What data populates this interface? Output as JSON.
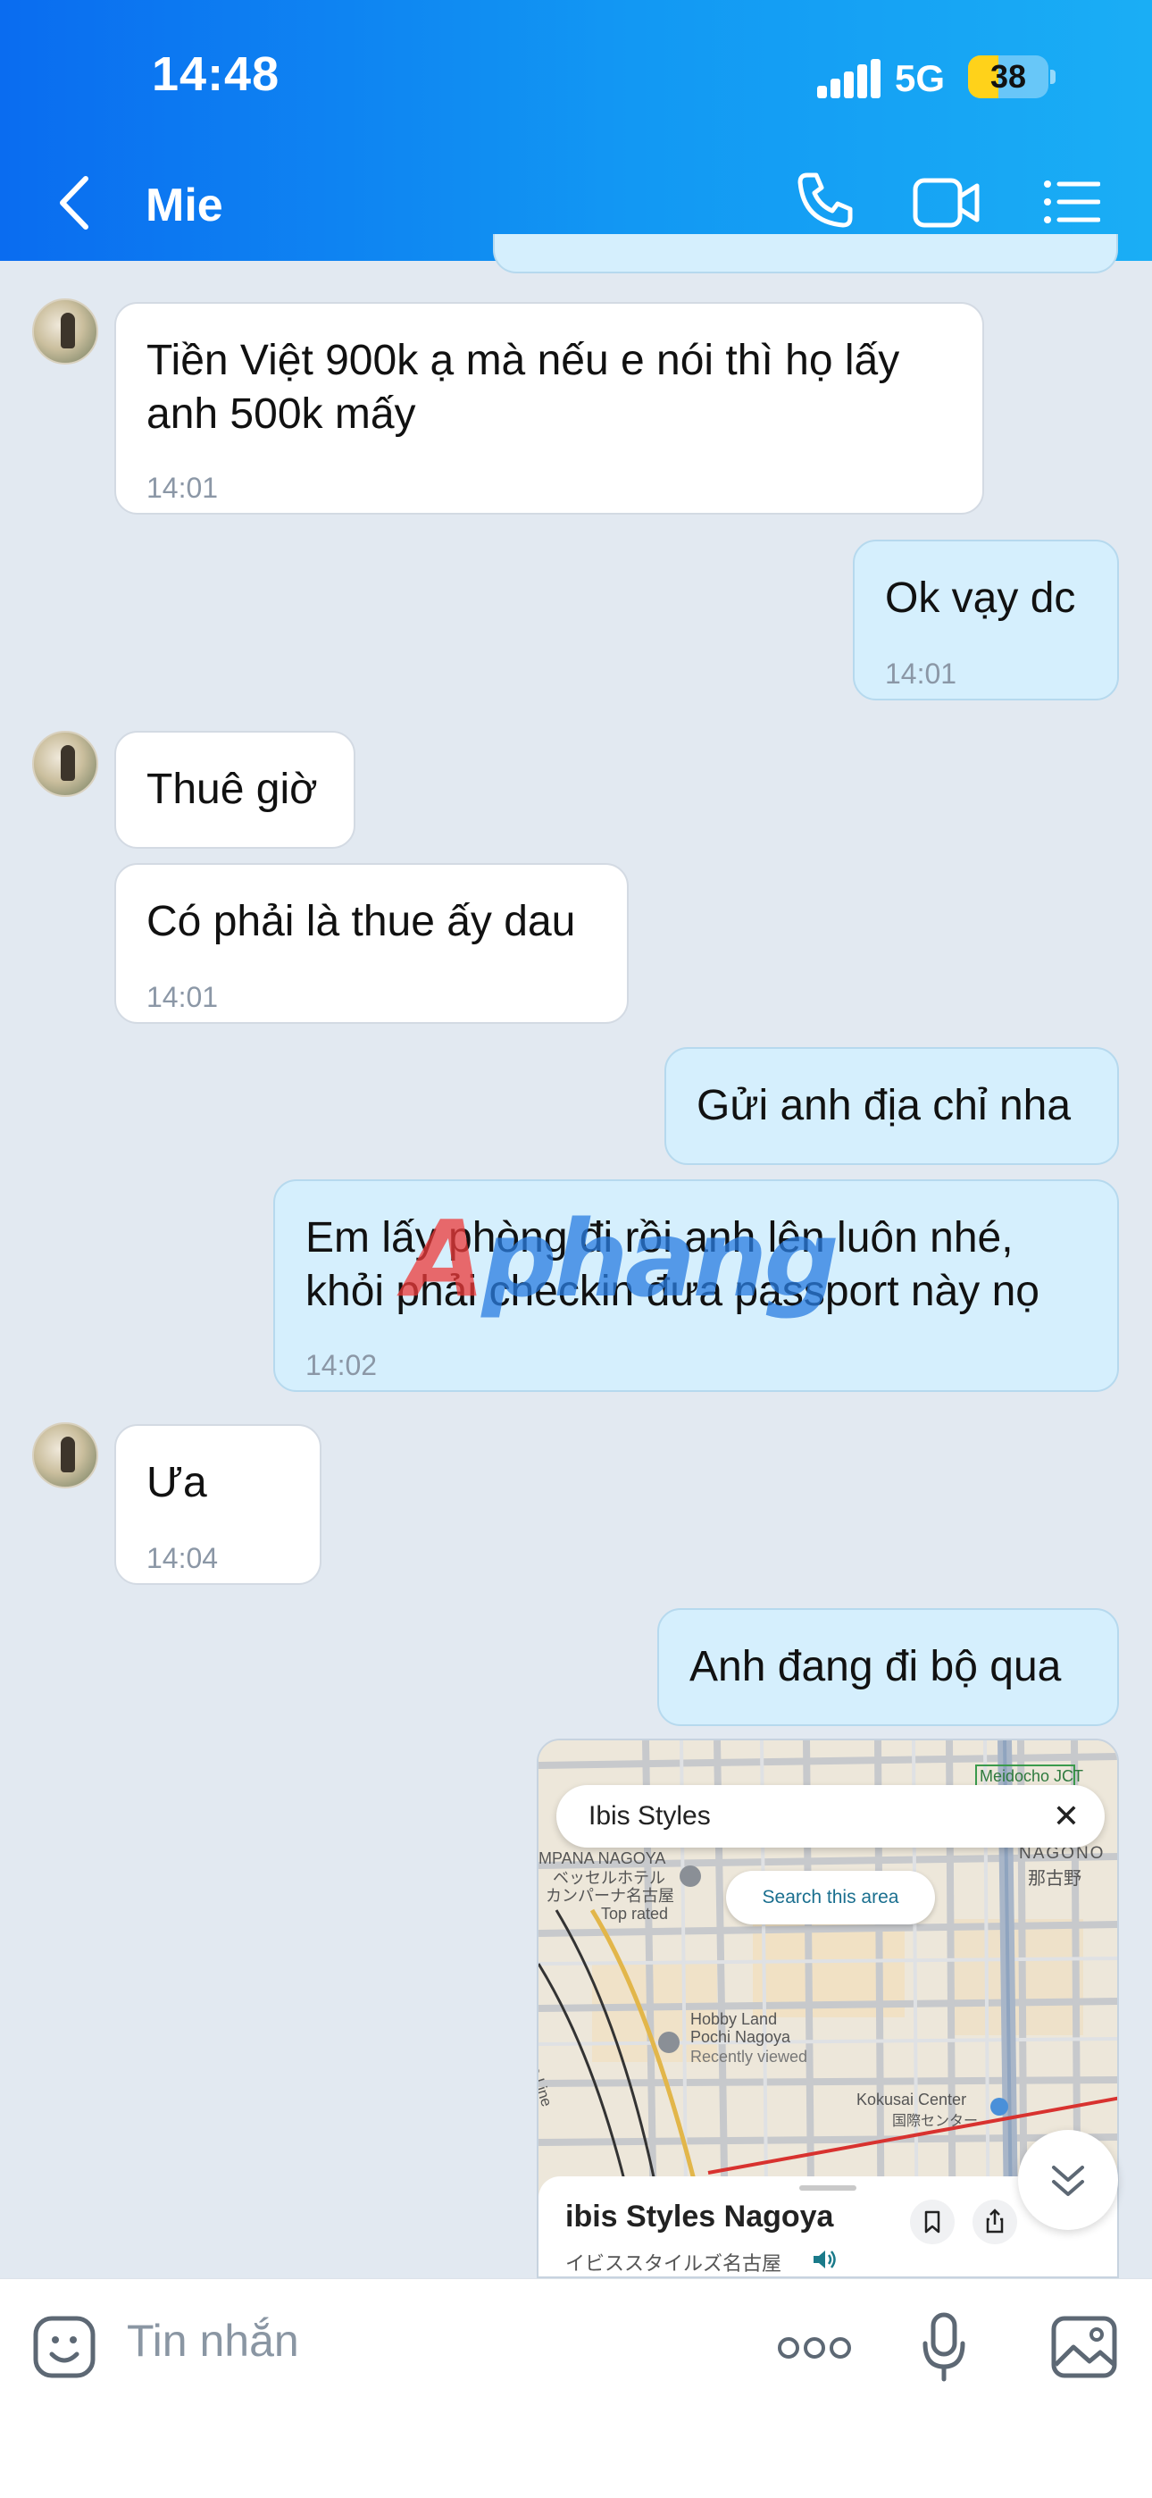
{
  "status_bar": {
    "time": "14:48",
    "network": "5G",
    "battery": "38",
    "battery_level": 0.38
  },
  "header": {
    "contact_name": "Mie",
    "icons": [
      "back-chevron-icon",
      "phone-icon",
      "video-camera-icon",
      "list-menu-icon"
    ]
  },
  "messages": [
    {
      "side": "in",
      "text": "Tiền Việt 900k ạ mà nếu e nói thì họ lấy anh 500k mấy",
      "time": "14:01"
    },
    {
      "side": "out",
      "text": "Ok vạy dc",
      "time": "14:01"
    },
    {
      "side": "in",
      "text": "Thuê giờ",
      "time": ""
    },
    {
      "side": "in",
      "text": "Có phải là thue ấy dau",
      "time": "14:01"
    },
    {
      "side": "out",
      "text": "Gửi anh địa chỉ nha",
      "time": ""
    },
    {
      "side": "out",
      "text": "Em lấy phòng đi rồi anh lên luôn nhé, khỏi phải checkin đưa passport này nọ",
      "time": "14:02"
    },
    {
      "side": "in",
      "text": "Ưa",
      "time": "14:04"
    },
    {
      "side": "out",
      "text": "Anh đang đi bộ qua",
      "time": ""
    }
  ],
  "watermark": {
    "part1": "A",
    "part2": "phang"
  },
  "map_card": {
    "search_text": "Ibis Styles",
    "search_area_button": "Search this area",
    "place_name": "ibis Styles Nagoya",
    "place_subtitle": "イビススタイルズ名古屋",
    "labels": {
      "meidocho": "Meidocho JCT",
      "nagono": "NAGONO",
      "nagono_jp": "那古野",
      "campana": "MPANA NAGOYA",
      "campana_jp1": "ベッセルホテル",
      "campana_jp2": "カンパーナ名古屋",
      "top_rated": "Top rated",
      "hobby1": "Hobby Land",
      "hobby2": "Pochi Nagoya",
      "recently": "Recently viewed",
      "kokusai": "Kokusai Center",
      "kokusai_jp": "国際センター",
      "line": "Meitetsu Nagoya Line"
    }
  },
  "input_bar": {
    "placeholder": "Tin nhắn",
    "icons": [
      "sticker-icon",
      "more-dots-icon",
      "microphone-icon",
      "image-icon"
    ]
  }
}
